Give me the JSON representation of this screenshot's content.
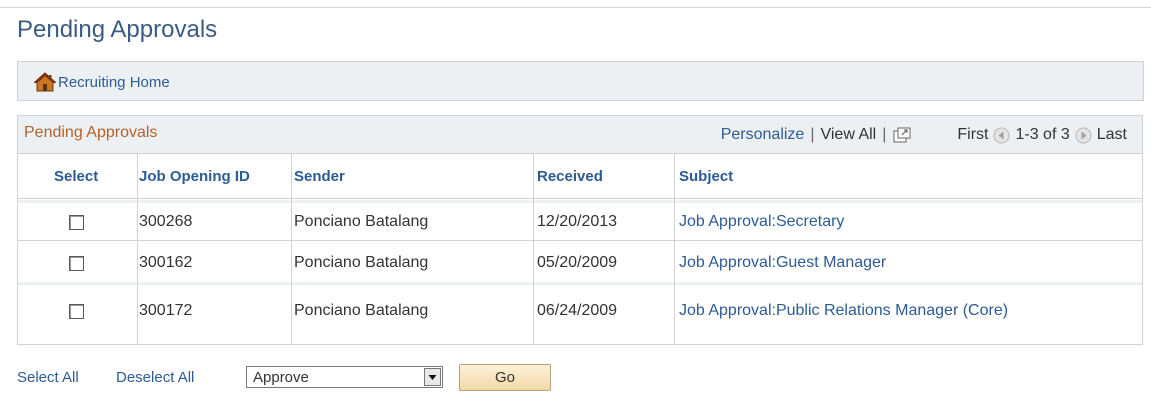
{
  "page": {
    "title": "Pending Approvals"
  },
  "home": {
    "label": "Recruiting Home",
    "icon": "home-icon"
  },
  "grid": {
    "title": "Pending Approvals",
    "personalize": "Personalize",
    "view_all": "View All",
    "first": "First",
    "range": "1-3 of 3",
    "last": "Last",
    "columns": {
      "select": "Select",
      "job_id": "Job Opening ID",
      "sender": "Sender",
      "received": "Received",
      "subject": "Subject"
    },
    "rows": [
      {
        "selected": false,
        "job_id": "300268",
        "sender": "Ponciano Batalang",
        "received": "12/20/2013",
        "subject": "Job Approval:Secretary"
      },
      {
        "selected": false,
        "job_id": "300162",
        "sender": "Ponciano Batalang",
        "received": "05/20/2009",
        "subject": "Job Approval:Guest Manager"
      },
      {
        "selected": false,
        "job_id": "300172",
        "sender": "Ponciano Batalang",
        "received": "06/24/2009",
        "subject": "Job Approval:Public Relations Manager (Core)"
      }
    ]
  },
  "footer": {
    "select_all": "Select All",
    "deselect_all": "Deselect All",
    "action_value": "Approve",
    "go_label": "Go"
  },
  "colors": {
    "link": "#2d5b94",
    "title": "#3b5b84",
    "grid_title": "#b0632b",
    "header_bg": "#edf0f3"
  }
}
